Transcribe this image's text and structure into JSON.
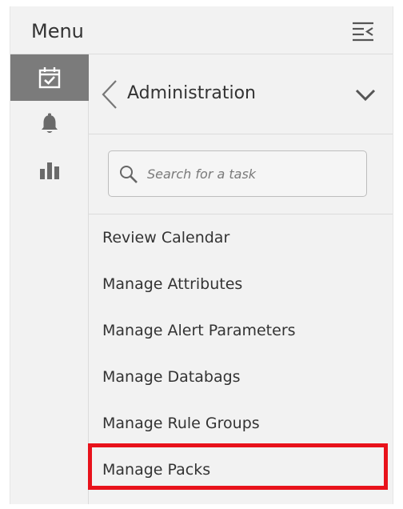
{
  "header": {
    "title": "Menu",
    "collapse_icon": "menu-collapse-icon"
  },
  "rail": {
    "items": [
      {
        "icon": "calendar-check-icon",
        "active": true
      },
      {
        "icon": "bell-icon",
        "active": false
      },
      {
        "icon": "bar-chart-icon",
        "active": false
      }
    ]
  },
  "section": {
    "title": "Administration",
    "back_icon": "chevron-left-icon",
    "expand_icon": "chevron-down-icon"
  },
  "search": {
    "placeholder": "Search for a task",
    "value": "",
    "icon": "search-icon"
  },
  "tasks": [
    {
      "label": "Review Calendar"
    },
    {
      "label": "Manage Attributes"
    },
    {
      "label": "Manage Alert Parameters"
    },
    {
      "label": "Manage Databags"
    },
    {
      "label": "Manage Rule Groups"
    },
    {
      "label": "Manage Packs",
      "highlighted": true
    }
  ],
  "colors": {
    "highlight": "#e8121b",
    "active_rail": "#7b7b7b",
    "panel_bg": "#f2f2f2",
    "text": "#333333"
  }
}
